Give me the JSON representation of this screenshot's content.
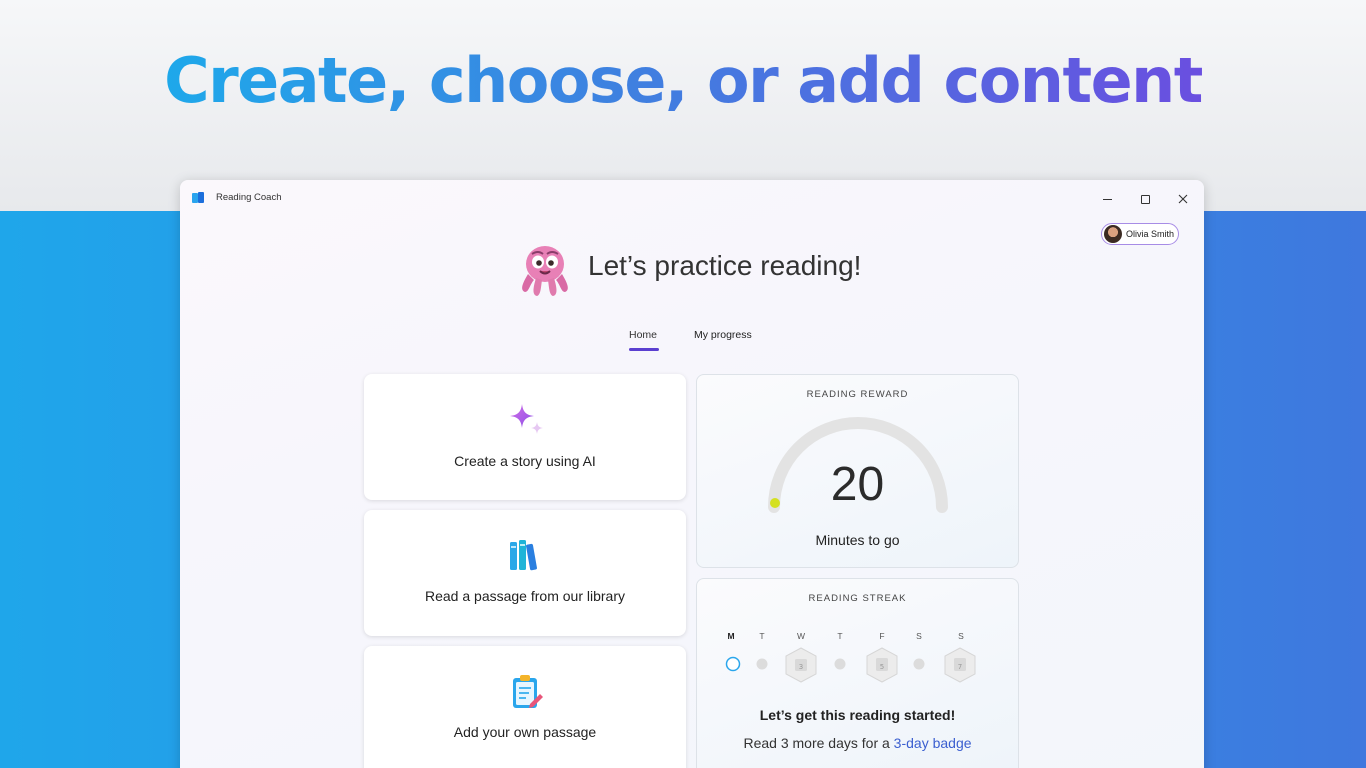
{
  "headline": "Create, choose, or add content",
  "window": {
    "title": "Reading Coach",
    "user": "Olivia Smith"
  },
  "greeting": "Let’s practice reading!",
  "tabs": [
    {
      "label": "Home",
      "selected": true
    },
    {
      "label": "My progress",
      "selected": false
    }
  ],
  "options": [
    {
      "label": "Create a story using AI",
      "icon": "sparkle-icon"
    },
    {
      "label": "Read a passage from our library",
      "icon": "books-icon"
    },
    {
      "label": "Add your own passage",
      "icon": "clipboard-pencil-icon"
    }
  ],
  "reward": {
    "title": "READING REWARD",
    "value": "20",
    "caption": "Minutes to go"
  },
  "streak": {
    "title": "READING STREAK",
    "days": [
      {
        "label": "M",
        "current": true
      },
      {
        "label": "T"
      },
      {
        "label": "W",
        "badge": "3"
      },
      {
        "label": "T"
      },
      {
        "label": "F",
        "badge": "5"
      },
      {
        "label": "S"
      },
      {
        "label": "S",
        "badge": "7"
      }
    ],
    "message": "Let’s get this reading started!",
    "sub_prefix": "Read 3 more days for a ",
    "sub_link": "3-day badge"
  },
  "colors": {
    "accent": "#5b3fd0",
    "link": "#3b5fd0",
    "gauge_dot": "#d4e020"
  }
}
